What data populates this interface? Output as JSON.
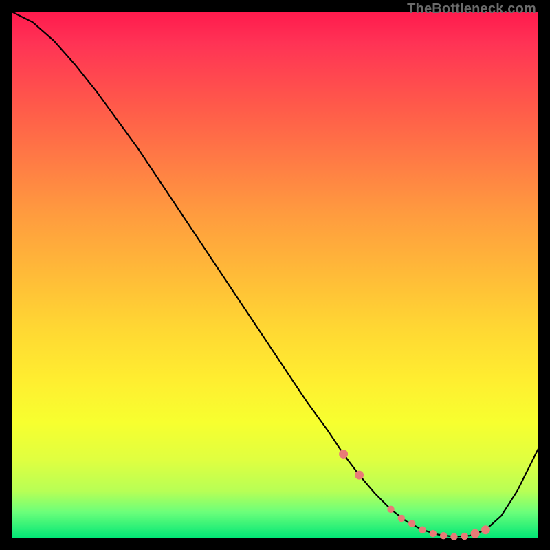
{
  "watermark": "TheBottleneck.com",
  "chart_data": {
    "type": "line",
    "title": "",
    "xlabel": "",
    "ylabel": "",
    "xlim": [
      0,
      100
    ],
    "ylim": [
      0,
      100
    ],
    "grid": false,
    "legend": false,
    "background": "rainbow-gradient",
    "series": [
      {
        "name": "bottleneck-curve",
        "x": [
          0,
          4,
          8,
          12,
          16,
          20,
          24,
          28,
          32,
          36,
          40,
          44,
          48,
          52,
          56,
          60,
          63,
          66,
          69,
          72,
          75,
          78,
          81,
          84,
          87,
          90,
          93,
          96,
          100
        ],
        "y": [
          100,
          98,
          94.5,
          90,
          85,
          79.5,
          74,
          68,
          62,
          56,
          50,
          44,
          38,
          32,
          26,
          20.5,
          16,
          12,
          8.5,
          5.5,
          3.2,
          1.6,
          0.7,
          0.3,
          0.5,
          1.6,
          4.3,
          9,
          17
        ]
      }
    ],
    "markers": {
      "name": "highlight-points",
      "x": [
        63,
        66,
        72,
        74,
        76,
        78,
        80,
        82,
        84,
        86,
        88,
        90
      ],
      "y": [
        16,
        12,
        5.5,
        3.8,
        2.8,
        1.6,
        0.9,
        0.5,
        0.3,
        0.4,
        0.9,
        1.6
      ]
    }
  }
}
